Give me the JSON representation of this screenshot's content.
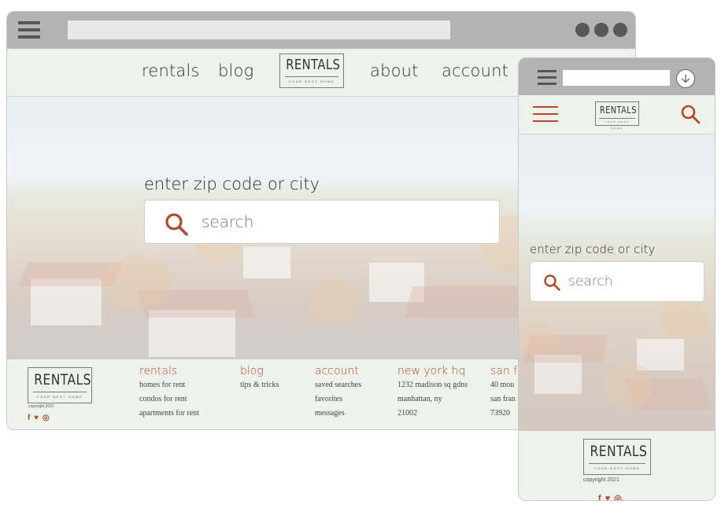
{
  "brand": {
    "logo_title": "RENTALS",
    "logo_tagline": "YOUR NEXT HOME",
    "copyright": "copyright 2021",
    "accent_color": "#b5472a",
    "background_color": "#eef2ec"
  },
  "desktop": {
    "nav": {
      "rentals": "rentals",
      "blog": "blog",
      "about": "about",
      "account": "account"
    },
    "hero": {
      "label": "enter zip code or city",
      "search_placeholder": "search"
    },
    "footer": {
      "social_icons": [
        "facebook-icon",
        "twitter-icon",
        "instagram-icon"
      ],
      "social_glyphs": "f ♥ ◎",
      "columns": [
        {
          "head": "rentals",
          "items": [
            "homes for rent",
            "condos for rent",
            "apartments for rent"
          ]
        },
        {
          "head": "blog",
          "items": [
            "tips & tricks"
          ]
        },
        {
          "head": "account",
          "items": [
            "saved searches",
            "favorites",
            "messages"
          ]
        },
        {
          "head": "new york hq",
          "items": [
            "1232 madison sq gdns",
            "manhattan, ny",
            "21002"
          ]
        },
        {
          "head": "san fr",
          "items": [
            "40 mou",
            "san fran",
            "73920"
          ]
        }
      ]
    }
  },
  "mobile": {
    "hero": {
      "label": "enter zip code or city",
      "search_placeholder": "search"
    },
    "footer": {
      "social_glyphs": "f ♥ ◎"
    }
  }
}
